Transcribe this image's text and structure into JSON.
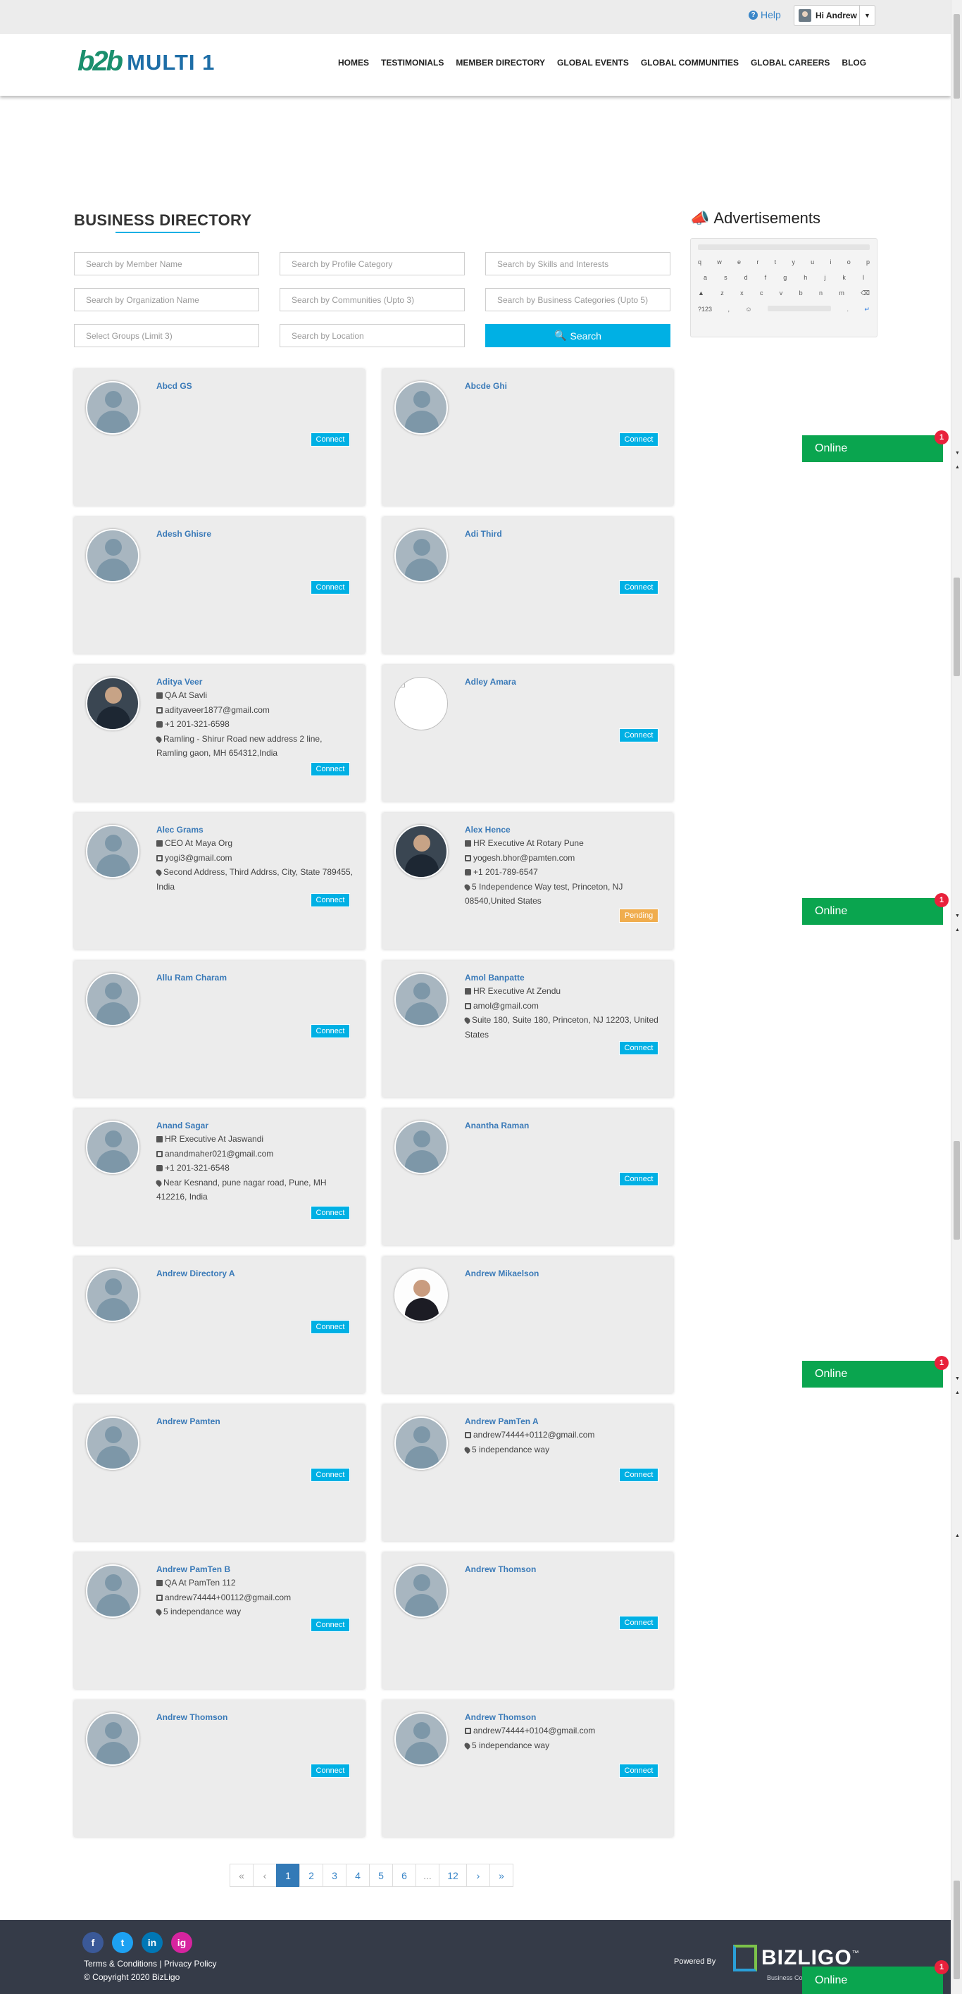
{
  "topbar": {
    "help_label": "Help",
    "user_greeting": "Hi Andrew"
  },
  "brand": {
    "logo_mark": "b2b",
    "logo_text": "MULTI 1"
  },
  "nav": [
    "HOMES",
    "TESTIMONIALS",
    "MEMBER DIRECTORY",
    "GLOBAL EVENTS",
    "GLOBAL COMMUNITIES",
    "GLOBAL CAREERS",
    "BLOG"
  ],
  "page_title": "BUSINESS DIRECTORY",
  "search": {
    "member_name": "Search by Member Name",
    "profile_category": "Search by Profile Category",
    "skills": "Search by Skills and Interests",
    "organization": "Search by Organization Name",
    "communities": "Search by Communities (Upto 3)",
    "business_categories": "Search by Business Categories (Upto 5)",
    "groups": "Select Groups (Limit 3)",
    "location": "Search by Location",
    "button": "Search"
  },
  "ads": {
    "title": "Advertisements",
    "keyboard_rows": [
      [
        "q",
        "w",
        "e",
        "r",
        "t",
        "y",
        "u",
        "i",
        "o",
        "p"
      ],
      [
        "a",
        "s",
        "d",
        "f",
        "g",
        "h",
        "j",
        "k",
        "l"
      ],
      [
        "z",
        "x",
        "c",
        "v",
        "b",
        "n",
        "m"
      ]
    ],
    "keyboard_extra": [
      "?123",
      ",",
      "☺",
      "."
    ]
  },
  "members": [
    {
      "name": "Abcd GS",
      "avatar": "placeholder",
      "action": "Connect"
    },
    {
      "name": "Abcde Ghi",
      "avatar": "placeholder",
      "action": "Connect"
    },
    {
      "name": "Adesh Ghisre",
      "avatar": "placeholder",
      "action": "Connect"
    },
    {
      "name": "Adi Third",
      "avatar": "placeholder",
      "action": "Connect"
    },
    {
      "name": "Aditya Veer",
      "avatar": "photo",
      "role": "QA At Savli",
      "email": "adityaveer1877@gmail.com",
      "phone": "+1 201-321-6598",
      "address": "Ramling - Shirur Road new address 2 line, Ramling gaon, MH 654312,India",
      "action": "Connect"
    },
    {
      "name": "Adley Amara",
      "avatar": "broken",
      "action": "Connect"
    },
    {
      "name": "Alec Grams",
      "avatar": "placeholder",
      "role": "CEO At Maya Org",
      "email": "yogi3@gmail.com",
      "address": "Second Address, Third Addrss, City, State 789455, India",
      "action": "Connect"
    },
    {
      "name": "Alex Hence",
      "avatar": "photo",
      "role": "HR Executive At Rotary Pune",
      "email": "yogesh.bhor@pamten.com",
      "phone": "+1 201-789-6547",
      "address": "5 Independence Way test, Princeton, NJ 08540,United States",
      "action": "Pending"
    },
    {
      "name": "Allu Ram Charam",
      "avatar": "placeholder",
      "action": "Connect"
    },
    {
      "name": "Amol Banpatte",
      "avatar": "placeholder",
      "role": "HR Executive At Zendu",
      "email": "amol@gmail.com",
      "address": "Suite 180, Suite 180, Princeton, NJ 12203, United States",
      "action": "Connect"
    },
    {
      "name": "Anand Sagar",
      "avatar": "placeholder",
      "role": "HR Executive At Jaswandi",
      "email": "anandmaher021@gmail.com",
      "phone": "+1 201-321-6548",
      "address": "Near Kesnand, pune nagar road, Pune, MH 412216, India",
      "action": "Connect"
    },
    {
      "name": "Anantha Raman",
      "avatar": "placeholder",
      "action": "Connect"
    },
    {
      "name": "Andrew Directory A",
      "avatar": "placeholder",
      "action": "Connect"
    },
    {
      "name": "Andrew Mikaelson",
      "avatar": "photo-light"
    },
    {
      "name": "Andrew Pamten",
      "avatar": "placeholder",
      "action": "Connect"
    },
    {
      "name": "Andrew PamTen A",
      "avatar": "placeholder",
      "email": "andrew74444+0112@gmail.com",
      "address": "5 independance way",
      "action": "Connect"
    },
    {
      "name": "Andrew PamTen B",
      "avatar": "placeholder",
      "role": "QA At PamTen 112",
      "email": "andrew74444+00112@gmail.com",
      "address": "5 independance way",
      "action": "Connect"
    },
    {
      "name": "Andrew Thomson",
      "avatar": "placeholder",
      "action": "Connect"
    },
    {
      "name": "Andrew Thomson",
      "avatar": "placeholder",
      "action": "Connect"
    },
    {
      "name": "Andrew Thomson",
      "avatar": "placeholder",
      "email": "andrew74444+0104@gmail.com",
      "address": "5 independance way",
      "action": "Connect"
    }
  ],
  "pagination": [
    "«",
    "‹",
    "1",
    "2",
    "3",
    "4",
    "5",
    "6",
    "...",
    "12",
    "›",
    "»"
  ],
  "pagination_active": "1",
  "online_widget": {
    "label": "Online",
    "badge": "1"
  },
  "footer": {
    "social": [
      "f",
      "t",
      "in",
      "ig"
    ],
    "links": "Terms & Conditions | Privacy Policy",
    "copyright": "© Copyright 2020 BizLigo",
    "powered_by": "Powered By",
    "brand": "BIZLIGO",
    "brand_tm": "™",
    "brand_sub": "Business Co"
  },
  "colors": {
    "accent": "#00b0e4",
    "link": "#3a7ab8",
    "pending": "#f0ad4e",
    "online": "#0aa54f",
    "badge": "#e8213b",
    "footer_bg": "#353b48"
  }
}
